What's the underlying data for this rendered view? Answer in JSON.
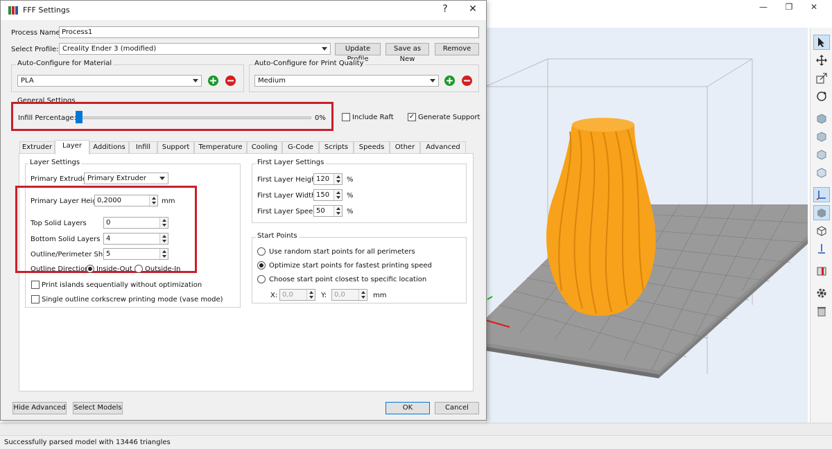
{
  "dialog": {
    "title": "FFF Settings",
    "help": "?",
    "close": "✕",
    "process_name_label": "Process Name:",
    "process_name_value": "Process1",
    "select_profile_label": "Select Profile:",
    "select_profile_value": "Creality Ender 3 (modified)",
    "update_profile": "Update Profile",
    "save_as_new": "Save as New",
    "remove": "Remove",
    "material_group_title": "Auto-Configure for Material",
    "material_value": "PLA",
    "quality_group_title": "Auto-Configure for Print Quality",
    "quality_value": "Medium",
    "general_title": "General Settings",
    "infill_label": "Infill Percentage:",
    "infill_value_text": "0%",
    "infill_fraction": 0,
    "include_raft": "Include Raft",
    "include_raft_checked": false,
    "generate_support": "Generate Support",
    "generate_support_checked": true,
    "tabs": [
      "Extruder",
      "Layer",
      "Additions",
      "Infill",
      "Support",
      "Temperature",
      "Cooling",
      "G-Code",
      "Scripts",
      "Speeds",
      "Other",
      "Advanced"
    ],
    "active_tab": "Layer",
    "hide_advanced": "Hide Advanced",
    "select_models": "Select Models",
    "ok": "OK",
    "cancel": "Cancel"
  },
  "layer": {
    "layer_settings_title": "Layer Settings",
    "primary_extruder_label": "Primary Extruder",
    "primary_extruder_value": "Primary Extruder",
    "primary_layer_height_label": "Primary Layer Height",
    "primary_layer_height_value": "0,2000",
    "primary_layer_height_unit": "mm",
    "top_solid_label": "Top Solid Layers",
    "top_solid_value": "0",
    "bottom_solid_label": "Bottom Solid Layers",
    "bottom_solid_value": "4",
    "shells_label": "Outline/Perimeter Shells",
    "shells_value": "5",
    "outline_direction_label": "Outline Direction:",
    "inside_out": "Inside-Out",
    "outside_in": "Outside-In",
    "print_islands": "Print islands sequentially without optimization",
    "single_outline": "Single outline corkscrew printing mode (vase mode)",
    "first_layer_title": "First Layer Settings",
    "first_height_label": "First Layer Height",
    "first_height_value": "120",
    "first_width_label": "First Layer Width",
    "first_width_value": "150",
    "first_speed_label": "First Layer Speed",
    "first_speed_value": "50",
    "percent": "%",
    "start_points_title": "Start Points",
    "sp_random": "Use random start points for all perimeters",
    "sp_optimize": "Optimize start points for fastest printing speed",
    "sp_closest": "Choose start point closest to specific location",
    "x_label": "X:",
    "x_value": "0,0",
    "y_label": "Y:",
    "y_value": "0,0",
    "xy_unit": "mm"
  },
  "status": {
    "text": "Successfully parsed model with 13446 triangles"
  },
  "colors": {
    "highlight": "#c8202a",
    "model": "#f7a21a",
    "bed": "#8a8a8a",
    "viewport_bg": "#e7eef7"
  }
}
